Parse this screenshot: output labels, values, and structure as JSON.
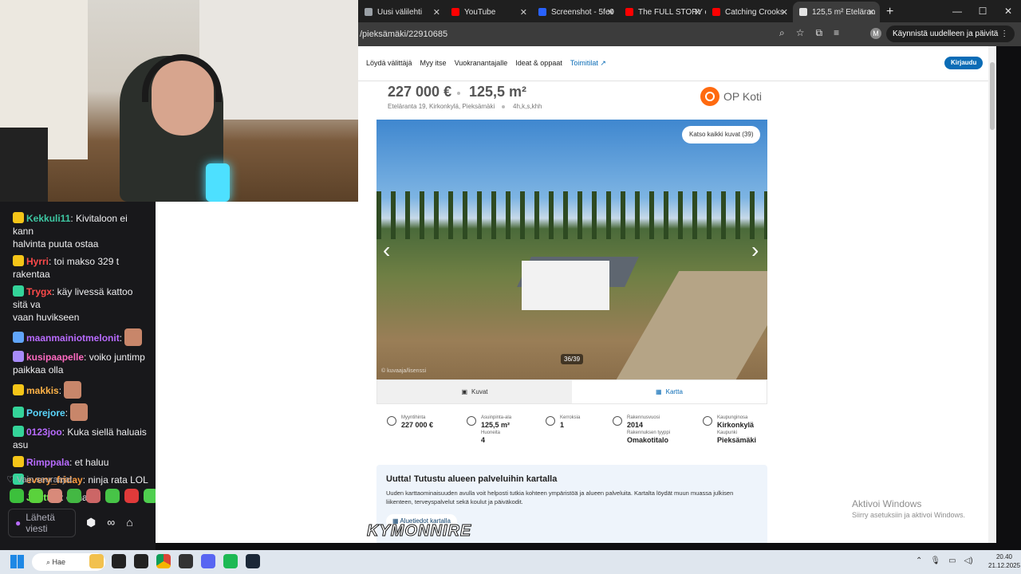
{
  "chat": {
    "messages": [
      {
        "user": "Kekkuli11",
        "text": ": Kivitaloon ei kann",
        "cont": "halvinta puuta ostaa",
        "color": "#3ec8a3"
      },
      {
        "user": "Hyrri",
        "text": ": toi makso 329 t rakentaa",
        "cont": "",
        "color": "#ff4a4a"
      },
      {
        "user": "Trygx",
        "text": ": käy livessä kattoo sitä va",
        "cont": "vaan huvikseen",
        "color": "#ff4a4a"
      },
      {
        "user": "maanmainiotmelonit",
        "text": ":",
        "cont": "",
        "color": "#b86bff"
      },
      {
        "user": "kusipaapelle",
        "text": ": voiko juntimp",
        "cont": "paikkaa olla",
        "color": "#ff6ac1"
      },
      {
        "user": "makkis",
        "text": ":",
        "cont": "",
        "color": "#ffb347"
      },
      {
        "user": "Porejore",
        "text": ":",
        "cont": "",
        "color": "#5ad7ff"
      },
      {
        "user": "0123joo",
        "text": ": Kuka siellä haluais asu",
        "cont": "",
        "color": "#b86bff"
      },
      {
        "user": "Rimppala",
        "text": ": et haluu",
        "cont": "",
        "color": "#b86bff"
      },
      {
        "user": "every_friday",
        "text": ": ninja rata LOL",
        "cont": "",
        "color": "#ff9b3d"
      },
      {
        "user": "Jonttu1",
        "text": ": et halua",
        "cont": "",
        "color": "#7cff5a"
      }
    ],
    "follow_only": "Vain seuraajat",
    "send_label": "Lähetä viesti"
  },
  "browser": {
    "tabs": [
      {
        "title": "Uusi välilehti",
        "fav": "#9aa0a6"
      },
      {
        "title": "YouTube",
        "fav": "#ff0000"
      },
      {
        "title": "Screenshot - 5fe9",
        "fav": "#2962ff"
      },
      {
        "title": "The FULL STORY o",
        "fav": "#ff0000"
      },
      {
        "title": "Catching Crooks",
        "fav": "#ff0000"
      },
      {
        "title": "125,5 m² Eteläran",
        "fav": "#e3e3e3"
      }
    ],
    "url": "/pieksämäki/22910685",
    "restart": "Käynnistä uudelleen ja päivitä",
    "profile": "M"
  },
  "site": {
    "nav": [
      "Löydä välittäjä",
      "Myy itse",
      "Vuokranantajalle",
      "Ideat & oppaat"
    ],
    "nav_link": "Toimitilat",
    "login": "Kirjaudu",
    "price": "227 000 €",
    "area": "125,5 m²",
    "address": "Eteläranta 19, Kirkonkylä, Pieksämäki",
    "rooms": "4h,k,s,khh",
    "brand": "OP Koti",
    "all_photos": "Katso kaikki kuvat (39)",
    "counter": "36/39",
    "photo_credit": "© kuvaaja/lisenssi",
    "view_pics": "Kuvat",
    "view_map": "Kartta",
    "facts": [
      {
        "label": "Myyntihinta",
        "value": "227 000 €"
      },
      {
        "label": "Asuinpinta-ala",
        "value": "125,5 m²"
      },
      {
        "label": "Huoneita",
        "value": "4"
      },
      {
        "label": "Kerroksia",
        "value": "1"
      },
      {
        "label": "Rakennusvuosi",
        "value": "2014"
      },
      {
        "label": "Rakennuksen tyyppi",
        "value": "Omakotitalo"
      },
      {
        "label": "Kaupunginosa",
        "value": "Kirkonkylä"
      },
      {
        "label": "Kaupunki",
        "value": "Pieksämäki"
      }
    ],
    "info_title": "Uutta! Tutustu alueen palveluihin kartalla",
    "info_text": "Uuden karttaominaisuuden avulla voit helposti tutkia kohteen ympäristöä ja alueen palveluita. Kartalta löydät muun muassa julkisen liikenteen, terveyspalvelut sekä koulut ja päiväkodit.",
    "info_button": "Aluetiedot kartalla"
  },
  "activate": {
    "title": "Aktivoi Windows",
    "sub": "Siirry asetuksiin ja aktivoi Windows."
  },
  "overlay_logo": "KYMONNIRE",
  "taskbar": {
    "search": "Hae",
    "time": "20.40",
    "date": "21.12.2025"
  }
}
